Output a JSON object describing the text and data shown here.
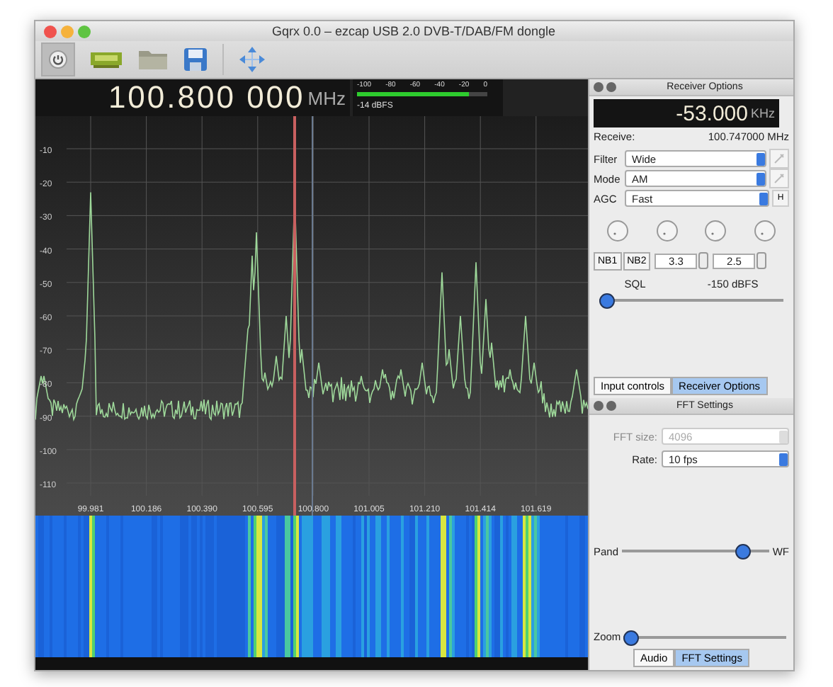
{
  "window": {
    "title": "Gqrx 0.0 – ezcap USB 2.0 DVB-T/DAB/FM dongle"
  },
  "toolbar": {
    "power_on": false
  },
  "frequency": {
    "value": "100.800 000",
    "unit": "MHz"
  },
  "meter": {
    "scale": [
      "-100",
      "-80",
      "-60",
      "-40",
      "-20",
      "0"
    ],
    "level": 0.86,
    "reading": "-14 dBFS"
  },
  "spectrum": {
    "y_ticks": [
      "-10",
      "-20",
      "-30",
      "-40",
      "-50",
      "-60",
      "-70",
      "-80",
      "-90",
      "-100",
      "-110"
    ],
    "x_ticks": [
      "99.981",
      "100.186",
      "100.390",
      "100.595",
      "100.800",
      "101.005",
      "101.210",
      "101.414",
      "101.619"
    ]
  },
  "receiver_options": {
    "title": "Receiver Options",
    "offset": {
      "value": "-53.000",
      "unit": "KHz"
    },
    "receive_label": "Receive:",
    "receive_value": "100.747000 MHz",
    "combos": [
      {
        "label": "Filter",
        "value": "Wide",
        "button": {
          "kind": "icon"
        }
      },
      {
        "label": "Mode",
        "value": "AM",
        "button": {
          "kind": "icon"
        }
      },
      {
        "label": "AGC",
        "value": "Fast",
        "button": {
          "kind": "text",
          "label": "H"
        }
      }
    ],
    "nb_buttons": [
      {
        "label": "NB1",
        "checked": false
      },
      {
        "label": "NB2",
        "checked": false
      }
    ],
    "spinboxes": [
      "3.3",
      "2.5"
    ],
    "sql": {
      "label": "SQL",
      "reading": "-150 dBFS",
      "level": 0.0
    },
    "tabs": [
      {
        "label": "Input controls",
        "selected": false
      },
      {
        "label": "Receiver Options",
        "selected": true
      }
    ]
  },
  "fft_settings": {
    "title": "FFT Settings",
    "fields": [
      {
        "label": "FFT size:",
        "value": "4096",
        "disabled": true
      },
      {
        "label": "Rate:",
        "value": "10 fps",
        "disabled": false
      }
    ],
    "pand_slider": {
      "label": "Pand",
      "end_label": "WF",
      "level": 0.86
    },
    "zoom_slider": {
      "label": "Zoom",
      "level": 0.0
    },
    "tabs": [
      {
        "label": "Audio",
        "selected": false
      },
      {
        "label": "FFT Settings",
        "selected": true
      }
    ]
  }
}
